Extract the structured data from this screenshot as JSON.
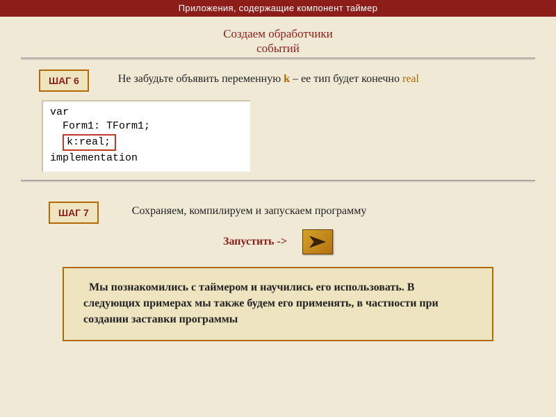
{
  "header": "Приложения, содержащие компонент таймер",
  "subtitle_line1": "Создаем обработчики",
  "subtitle_line2": "событий",
  "step6": {
    "badge": "ШАГ 6",
    "text_before": "Не забудьте объявить переменную ",
    "k": "k",
    "text_mid": " – ее тип будет конечно ",
    "real": "real"
  },
  "code": {
    "l1": "var",
    "l2": "  Form1: TForm1;",
    "l3": "k:real;",
    "l4": "implementation"
  },
  "step7": {
    "badge": "ШАГ 7",
    "text": "Сохраняем, компилируем и запускаем программу",
    "launch": "Запустить ->"
  },
  "summary": "Мы познакомились с таймером и научились его использовать. В следующих примерах мы также будем его применять, в частности при создании заставки программы"
}
